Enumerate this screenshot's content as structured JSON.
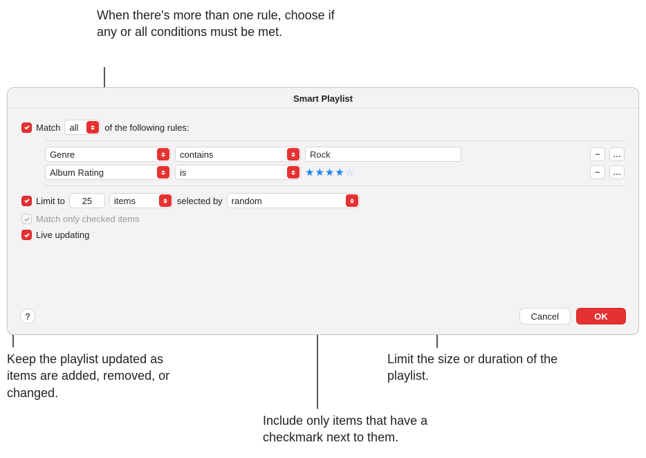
{
  "callouts": {
    "top": "When there's more than one rule, choose if any or all conditions must be met.",
    "left": "Keep the playlist updated as items are added, removed, or changed.",
    "middle": "Include only items that have a checkmark next to them.",
    "right": "Limit the size or duration of the playlist."
  },
  "dialog": {
    "title": "Smart Playlist",
    "match_label_prefix": "Match",
    "match_mode": "all",
    "match_label_suffix": "of the following rules:",
    "rules": [
      {
        "field": "Genre",
        "op": "contains",
        "value_text": "Rock",
        "type": "text"
      },
      {
        "field": "Album Rating",
        "op": "is",
        "stars_filled": 4,
        "type": "stars"
      }
    ],
    "limit": {
      "label": "Limit to",
      "count": "25",
      "unit": "items",
      "selected_by_label": "selected by",
      "method": "random"
    },
    "match_checked_label": "Match only checked items",
    "live_updating_label": "Live updating",
    "buttons": {
      "cancel": "Cancel",
      "ok": "OK"
    },
    "help": "?",
    "pill_minus": "−",
    "pill_more": "…"
  }
}
